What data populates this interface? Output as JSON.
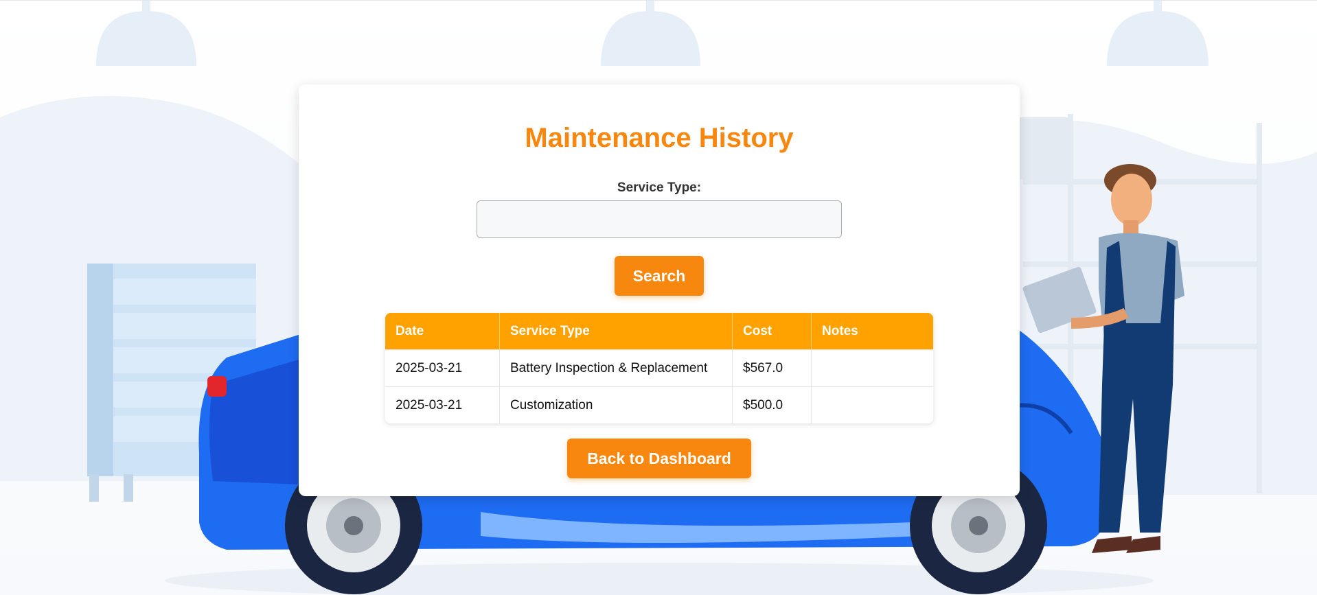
{
  "page": {
    "title": "Maintenance History"
  },
  "search": {
    "label": "Service Type:",
    "value": "",
    "placeholder": "",
    "button_label": "Search"
  },
  "table": {
    "headers": [
      "Date",
      "Service Type",
      "Cost",
      "Notes"
    ],
    "rows": [
      [
        "2025-03-21",
        "Battery Inspection & Replacement",
        "$567.0",
        ""
      ],
      [
        "2025-03-21",
        "Customization",
        "$500.0",
        ""
      ]
    ]
  },
  "actions": {
    "back_label": "Back to Dashboard"
  },
  "colors": {
    "accent": "#f7870e",
    "table_header": "#ffa200",
    "car": "#1e6cf2",
    "mechanic_overalls": "#123b73"
  },
  "background": {
    "illustration": "mechanic-with-laptop-beside-blue-car"
  }
}
